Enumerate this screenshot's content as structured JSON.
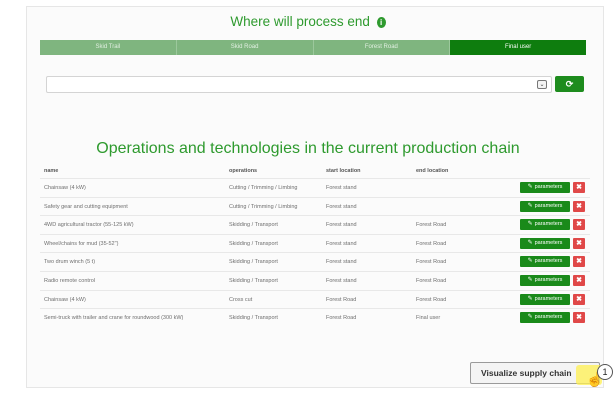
{
  "header": {
    "title": "Where will process end",
    "info_icon": "info-icon"
  },
  "tabs": [
    {
      "label": "Skid Trail",
      "active": false
    },
    {
      "label": "Skid Road",
      "active": false
    },
    {
      "label": "Forest Road",
      "active": false
    },
    {
      "label": "Final user",
      "active": true
    }
  ],
  "selector": {
    "value": "",
    "arrow_glyph": "⌄",
    "refresh_glyph": "⟳"
  },
  "chain": {
    "title": "Operations and technologies in the current production chain",
    "columns": {
      "name": "name",
      "operations": "operations",
      "start": "start location",
      "end": "end location"
    },
    "param_label": "parameters",
    "delete_glyph": "✖",
    "rows": [
      {
        "name": "Chainsaw (4 kW)",
        "operations": "Cutting / Trimming / Limbing",
        "start": "Forest stand",
        "end": ""
      },
      {
        "name": "Safety gear and cutting equipment",
        "operations": "Cutting / Trimming / Limbing",
        "start": "Forest stand",
        "end": ""
      },
      {
        "name": "4WD agricultural tractor (55-125 kW)",
        "operations": "Skidding / Transport",
        "start": "Forest stand",
        "end": "Forest Road"
      },
      {
        "name": "Wheel/chains for mud (35-52\")",
        "operations": "Skidding / Transport",
        "start": "Forest stand",
        "end": "Forest Road"
      },
      {
        "name": "Two drum winch (5 t)",
        "operations": "Skidding / Transport",
        "start": "Forest stand",
        "end": "Forest Road"
      },
      {
        "name": "Radio remote control",
        "operations": "Skidding / Transport",
        "start": "Forest stand",
        "end": "Forest Road"
      },
      {
        "name": "Chainsaw (4 kW)",
        "operations": "Cross cut",
        "start": "Forest Road",
        "end": "Forest Road"
      },
      {
        "name": "Semi-truck with trailer and crane for roundwood (300 kW)",
        "operations": "Skidding / Transport",
        "start": "Forest Road",
        "end": "Final user"
      }
    ]
  },
  "footer": {
    "visualize_label": "Visualize supply chain",
    "step_number": "1"
  },
  "colors": {
    "accent": "#2e9a2e",
    "tab_active": "#0e7d0e",
    "tab_inactive": "#7fb57f",
    "delete": "#e04848"
  }
}
